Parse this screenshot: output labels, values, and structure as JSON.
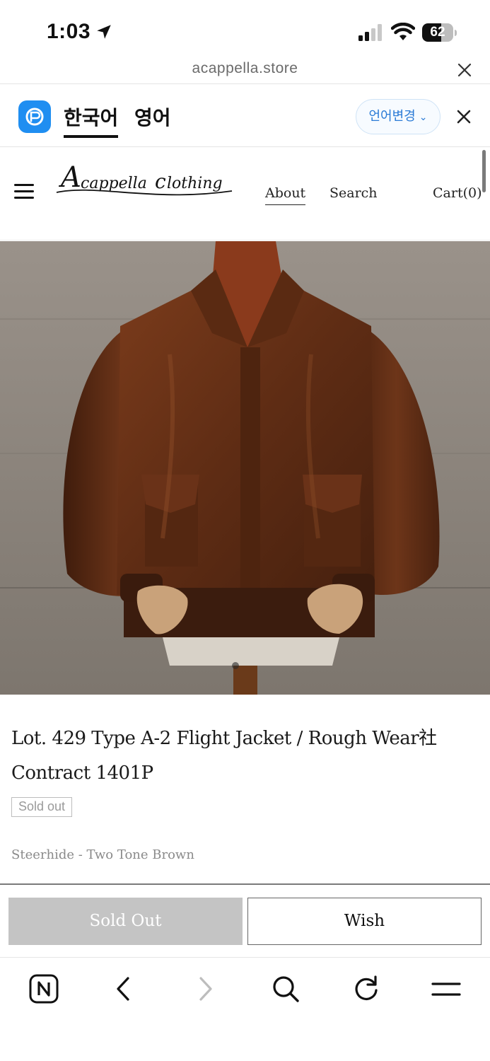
{
  "status_bar": {
    "time": "1:03",
    "battery": "62",
    "battery_level": 0.62
  },
  "url_bar": {
    "url": "acappella.store"
  },
  "translate_bar": {
    "current_language": "한국어",
    "other_language": "영어",
    "change_label": "언어변경"
  },
  "header": {
    "logo_text": "Acappella clothing",
    "nav": {
      "about": "About",
      "search": "Search",
      "cart": "Cart(0)"
    }
  },
  "product": {
    "title_line1": "Lot. 429 Type A-2 Flight Jacket / Rough Wear社",
    "title_line2": "Contract 1401P",
    "badge": "Sold out",
    "option": "Steerhide - Two Tone Brown"
  },
  "actions": {
    "sold_out_label": "Sold Out",
    "wish_label": "Wish"
  },
  "browser_toolbar": {
    "icons": [
      "naver-home-icon",
      "back-icon",
      "forward-icon",
      "search-icon",
      "reload-icon",
      "menu-icon"
    ]
  },
  "colors": {
    "accent_blue": "#2b7bd6",
    "papago_blue": "#1f8ef1",
    "leather_brown": "#6b3418"
  }
}
